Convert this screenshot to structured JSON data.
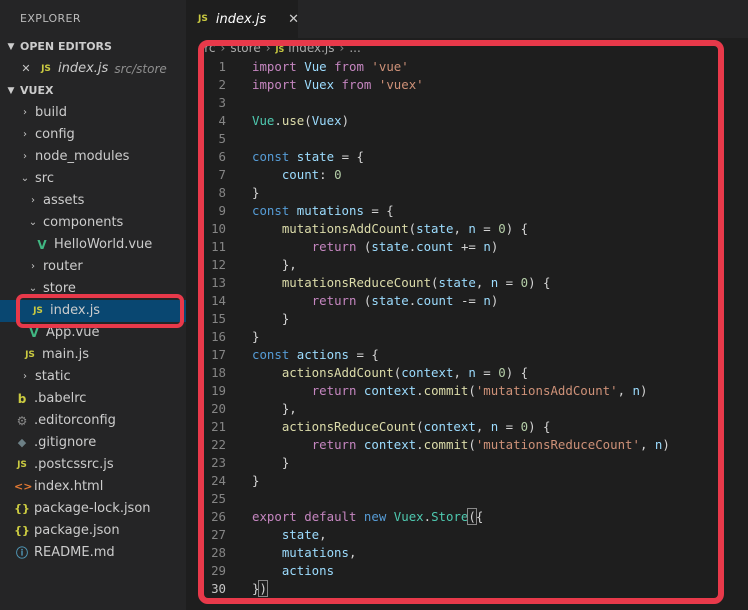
{
  "sidebar": {
    "title": "EXPLORER",
    "open_editors_header": "OPEN EDITORS",
    "open_editor": {
      "close": "✕",
      "icon": "JS",
      "name": "index.js",
      "path": "src/store"
    },
    "project_header": "VUEX",
    "tree": [
      {
        "name": "build",
        "icon": ""
      },
      {
        "name": "config",
        "icon": ""
      },
      {
        "name": "node_modules",
        "icon": ""
      },
      {
        "name": "src",
        "icon": ""
      },
      {
        "name": "assets",
        "icon": ""
      },
      {
        "name": "components",
        "icon": ""
      },
      {
        "name": "HelloWorld.vue",
        "icon": "V"
      },
      {
        "name": "router",
        "icon": ""
      },
      {
        "name": "store",
        "icon": ""
      },
      {
        "name": "index.js",
        "icon": "JS"
      },
      {
        "name": "App.vue",
        "icon": "V"
      },
      {
        "name": "main.js",
        "icon": "JS"
      },
      {
        "name": "static",
        "icon": ""
      },
      {
        "name": ".babelrc",
        "icon": "b"
      },
      {
        "name": ".editorconfig",
        "icon": "⚙"
      },
      {
        "name": ".gitignore",
        "icon": "◆"
      },
      {
        "name": ".postcssrc.js",
        "icon": "JS"
      },
      {
        "name": "index.html",
        "icon": "<>"
      },
      {
        "name": "package-lock.json",
        "icon": "{}"
      },
      {
        "name": "package.json",
        "icon": "{}"
      },
      {
        "name": "README.md",
        "icon": "ⓘ"
      }
    ]
  },
  "editor": {
    "tab": {
      "icon": "JS",
      "label": "index.js",
      "close": "✕"
    },
    "breadcrumb": {
      "p1": "src",
      "p2": "store",
      "icon": "JS",
      "p3": "index.js",
      "p4": "..."
    },
    "line_numbers": [
      "1",
      "2",
      "3",
      "4",
      "5",
      "6",
      "7",
      "8",
      "9",
      "10",
      "11",
      "12",
      "13",
      "14",
      "15",
      "16",
      "17",
      "18",
      "19",
      "20",
      "21",
      "22",
      "23",
      "24",
      "25",
      "26",
      "27",
      "28",
      "29",
      "30"
    ],
    "tokens": {
      "import": "import",
      "vue_id": "Vue",
      "vuex_id": "Vuex",
      "from": "from",
      "vue_str": "'vue'",
      "vuex_str": "'vuex'",
      "use": "use",
      "const": "const",
      "state": "state",
      "count": "count",
      "zero": "0",
      "mutations": "mutations",
      "add_count": "mutationsAddCount",
      "reduce_count": "mutationsReduceCount",
      "n": "n",
      "return": "return",
      "plus_eq": "+=",
      "minus_eq": "-=",
      "actions": "actions",
      "actions_add": "actionsAddCount",
      "actions_reduce": "actionsReduceCount",
      "context": "context",
      "commit": "commit",
      "add_str": "'mutationsAddCount'",
      "reduce_str": "'mutationsReduceCount'",
      "export": "export",
      "default": "default",
      "new": "new",
      "store_cls": "Store"
    }
  },
  "colors": {
    "accent_red": "#e8394a",
    "selection": "#094771",
    "sidebar_bg": "#252526",
    "editor_bg": "#1e1e1e"
  }
}
